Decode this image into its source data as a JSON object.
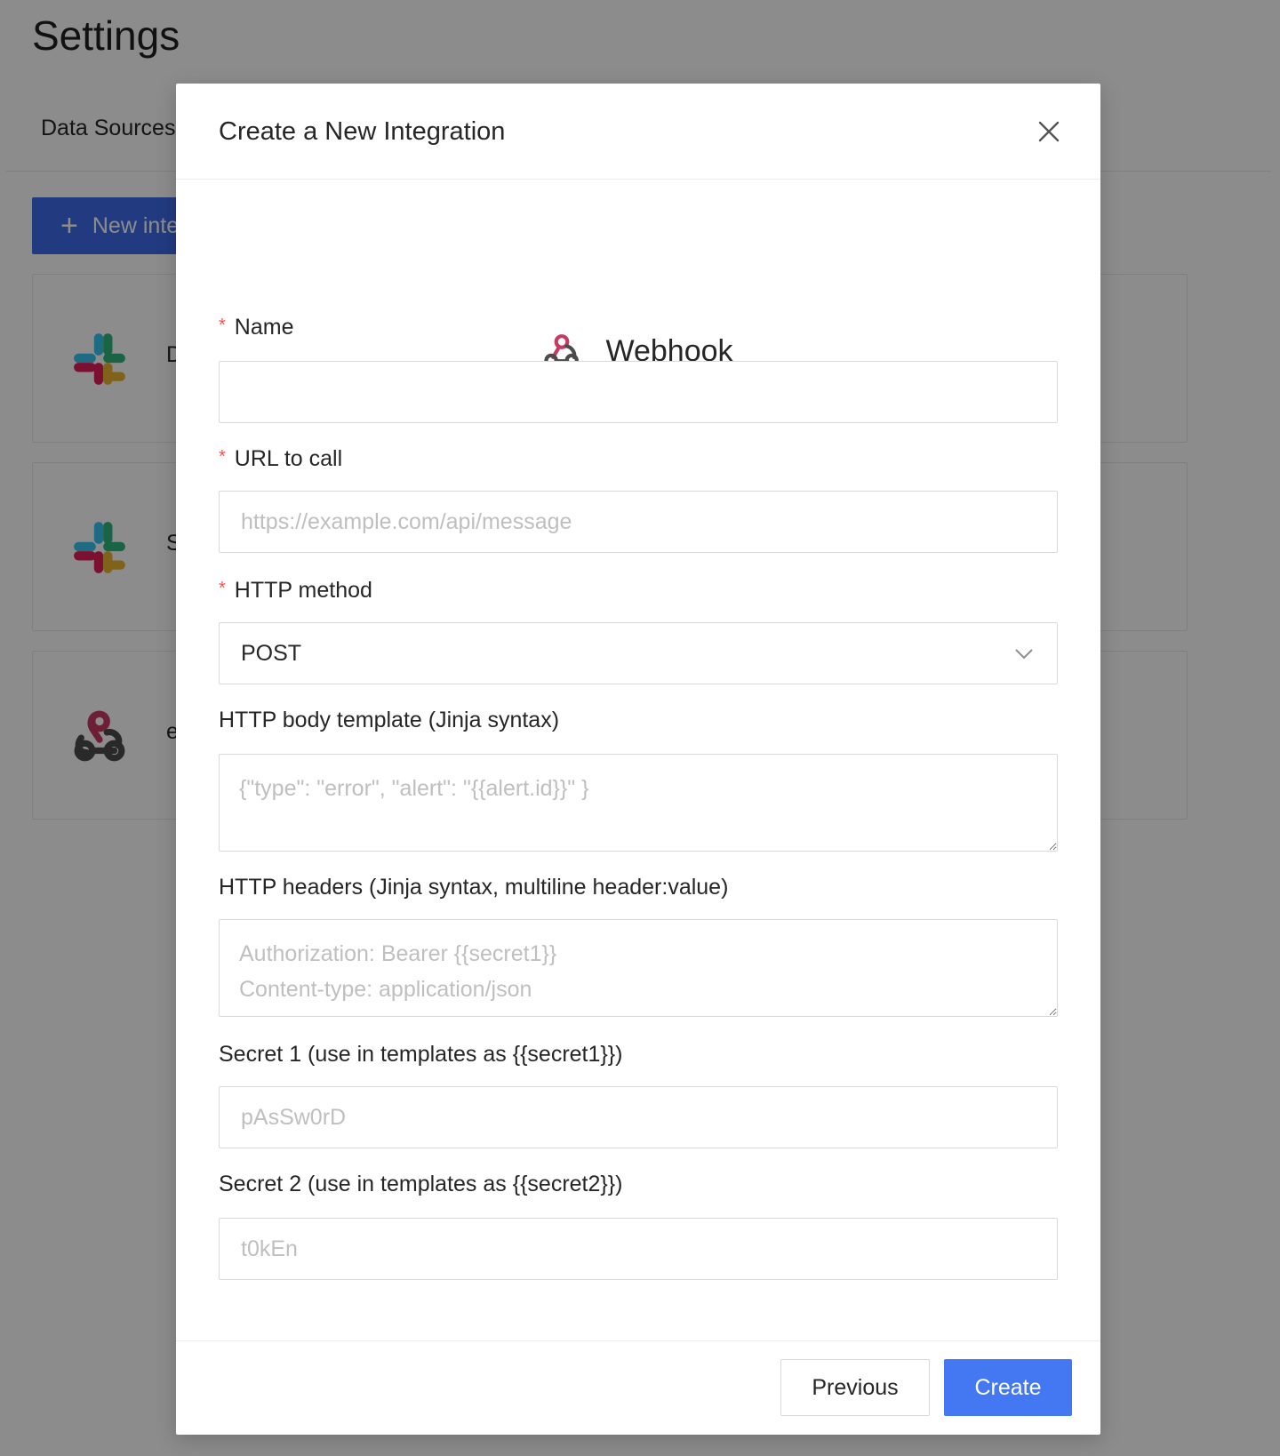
{
  "page": {
    "title": "Settings",
    "tabs": [
      {
        "label": "Data Sources"
      }
    ],
    "new_button_label": "New integration",
    "integration_cards": [
      {
        "icon": "slack-icon",
        "name": "D"
      },
      {
        "icon": "slack-icon",
        "name": "S"
      },
      {
        "icon": "webhook-icon",
        "name": "e"
      }
    ]
  },
  "modal": {
    "title": "Create a New Integration",
    "close_icon": "close-icon",
    "provider": {
      "icon": "webhook-icon",
      "name": "Webhook"
    },
    "fields": {
      "name": {
        "label": "Name",
        "required": true,
        "value": "",
        "placeholder": ""
      },
      "url": {
        "label": "URL to call",
        "required": true,
        "value": "",
        "placeholder": "https://example.com/api/message"
      },
      "method": {
        "label": "HTTP method",
        "required": true,
        "value": "POST"
      },
      "body": {
        "label": "HTTP body template (Jinja syntax)",
        "value": "",
        "placeholder": "{\"type\": \"error\", \"alert\": \"{{alert.id}}\" }"
      },
      "headers": {
        "label": "HTTP headers (Jinja syntax, multiline header:value)",
        "value": "",
        "placeholder": "Authorization: Bearer {{secret1}}\nContent-type: application/json"
      },
      "secret1": {
        "label": "Secret 1 (use in templates as {{secret1}})",
        "value": "",
        "placeholder": "pAsSw0rD"
      },
      "secret2": {
        "label": "Secret 2 (use in templates as {{secret2}})",
        "value": "",
        "placeholder": "t0kEn"
      }
    },
    "buttons": {
      "previous": "Previous",
      "create": "Create"
    }
  },
  "colors": {
    "primary": "#4478f2",
    "required": "#ff4d4f",
    "mask": "rgba(0,0,0,0.45)"
  }
}
